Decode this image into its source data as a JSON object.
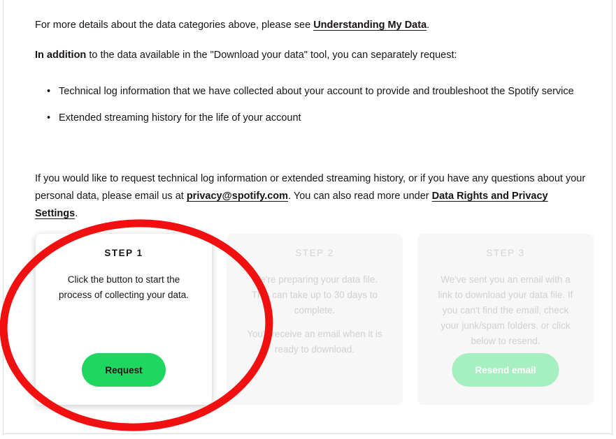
{
  "intro": {
    "text_before": "For more details about the data categories above, please see ",
    "link": "Understanding My Data",
    "text_after": "."
  },
  "addition": {
    "bold": "In addition",
    "text": " to the data available in the \"Download your data\" tool, you can separately request:"
  },
  "bullets": [
    "Technical log information that we have collected about your account to provide and troubleshoot the Spotify service",
    "Extended streaming history for the life of your account"
  ],
  "contact": {
    "text_before": "If you would like to request technical log information or extended streaming history, or if you have any questions about your personal data, please email us at ",
    "email": "privacy@spotify.com",
    "text_middle": ". You can also read more under ",
    "link": "Data Rights and Privacy Settings",
    "text_after": "."
  },
  "steps": [
    {
      "title": "STEP 1",
      "text": "Click the button to start the process of collecting your data.",
      "button": "Request"
    },
    {
      "title": "STEP 2",
      "text": "We're preparing your data file. This can take up to 30 days to complete.",
      "text2": "You'll receive an email when it is ready to download."
    },
    {
      "title": "STEP 3",
      "text": "We've sent you an email with a link to download your data file. If you can't find the email, check your junk/spam folders, or click below to resend.",
      "button": "Resend email"
    }
  ],
  "colors": {
    "spotify_green": "#1ed760",
    "disabled_green": "#a6efc0",
    "annotation_red": "#f01010"
  }
}
